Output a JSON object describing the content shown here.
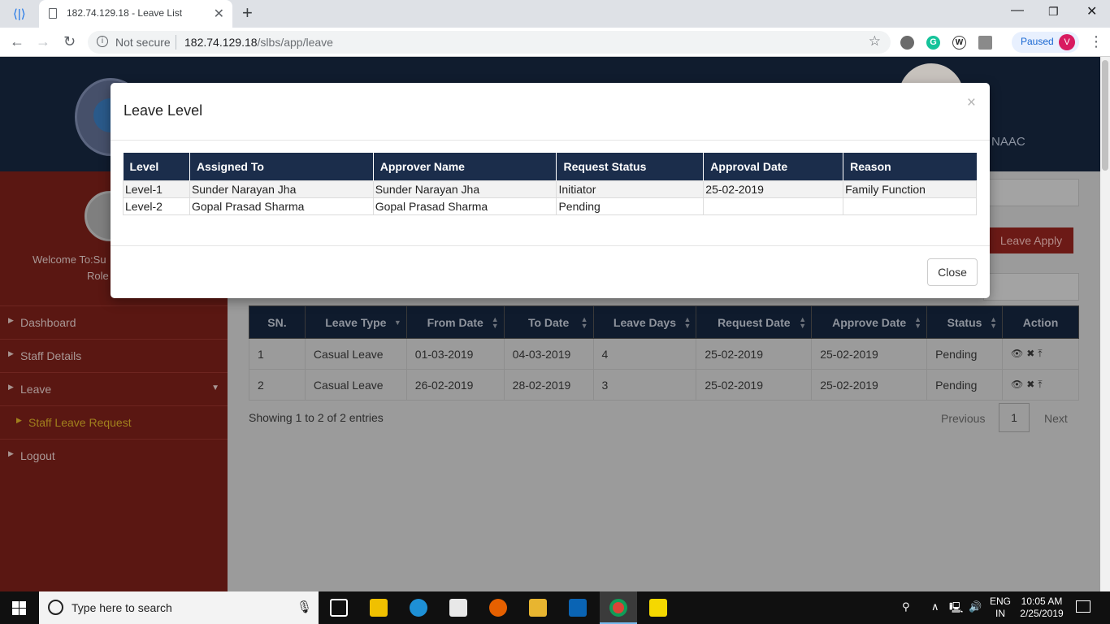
{
  "browser": {
    "tab_title": "182.74.129.18 - Leave List",
    "security_label": "Not secure",
    "url_host": "182.74.129.18",
    "url_path": "/slbs/app/leave",
    "profile_status": "Paused",
    "profile_initial": "V",
    "ext_w_letter": "W"
  },
  "header": {
    "naac_text": "NAAC"
  },
  "sidebar": {
    "welcome": "Welcome To:Su",
    "role": "Role",
    "items": [
      {
        "label": "Dashboard"
      },
      {
        "label": "Staff Details"
      },
      {
        "label": "Leave"
      },
      {
        "label": "Staff Leave Request"
      },
      {
        "label": "Logout"
      }
    ]
  },
  "actions": {
    "leave_apply": "Leave Apply"
  },
  "leave_table": {
    "columns": [
      "SN.",
      "Leave Type",
      "From Date",
      "To Date",
      "Leave Days",
      "Request Date",
      "Approve Date",
      "Status",
      "Action"
    ],
    "rows": [
      {
        "sn": "1",
        "leave_type": "Casual Leave",
        "from": "01-03-2019",
        "to": "04-03-2019",
        "days": "4",
        "request_date": "25-02-2019",
        "approve_date": "25-02-2019",
        "status": "Pending"
      },
      {
        "sn": "2",
        "leave_type": "Casual Leave",
        "from": "26-02-2019",
        "to": "28-02-2019",
        "days": "3",
        "request_date": "25-02-2019",
        "approve_date": "25-02-2019",
        "status": "Pending"
      }
    ],
    "showing": "Showing 1 to 2 of 2 entries",
    "pagination": {
      "previous": "Previous",
      "current": "1",
      "next": "Next"
    }
  },
  "modal": {
    "title": "Leave Level",
    "close_x": "×",
    "close_button": "Close",
    "columns": [
      "Level",
      "Assigned To",
      "Approver Name",
      "Request Status",
      "Approval Date",
      "Reason"
    ],
    "rows": [
      {
        "level": "Level-1",
        "assigned_to": "Sunder Narayan Jha",
        "approver": "Sunder Narayan Jha",
        "status": "Initiator",
        "approval_date": "25-02-2019",
        "reason": "Family Function"
      },
      {
        "level": "Level-2",
        "assigned_to": "Gopal Prasad Sharma",
        "approver": "Gopal Prasad Sharma",
        "status": "Pending",
        "approval_date": "",
        "reason": ""
      }
    ]
  },
  "taskbar": {
    "search_placeholder": "Type here to search",
    "lang_line1": "ENG",
    "lang_line2": "IN",
    "time": "10:05 AM",
    "date": "2/25/2019"
  },
  "colors": {
    "header_bg": "#101c2e",
    "sidebar_bg": "#5a1712",
    "modal_table_header": "#1b2d4b",
    "leave_apply_bg": "#6c1a16"
  }
}
